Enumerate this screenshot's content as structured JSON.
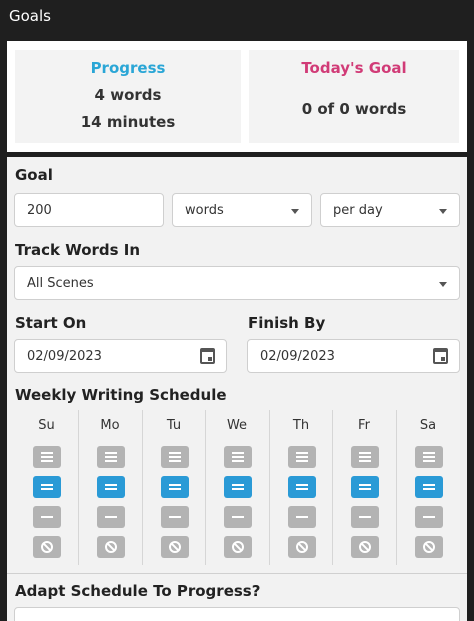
{
  "window": {
    "title": "Goals"
  },
  "progress": {
    "heading": "Progress",
    "words": "4 words",
    "minutes": "14 minutes"
  },
  "today_goal": {
    "heading": "Today's Goal",
    "value": "0 of 0 words"
  },
  "goal": {
    "label": "Goal",
    "amount": "200",
    "unit": "words",
    "period": "per day"
  },
  "track": {
    "label": "Track Words In",
    "value": "All Scenes"
  },
  "start": {
    "label": "Start On",
    "date": "02/09/2023"
  },
  "finish": {
    "label": "Finish By",
    "date": "02/09/2023"
  },
  "schedule": {
    "label": "Weekly Writing Schedule",
    "days": [
      "Su",
      "Mo",
      "Tu",
      "We",
      "Th",
      "Fr",
      "Sa"
    ],
    "selected_level": "equal"
  },
  "adapt": {
    "label": "Adapt Schedule To Progress?"
  },
  "colors": {
    "progress": "#2aa6d6",
    "today": "#d13b77",
    "active": "#2a9ad6",
    "inactive": "#b3b3b3"
  },
  "icons": {
    "schedule_buttons": [
      "more-icon",
      "equal-icon",
      "less-icon",
      "none-icon"
    ],
    "date": "calendar-icon",
    "select": "chevron-down-icon"
  }
}
